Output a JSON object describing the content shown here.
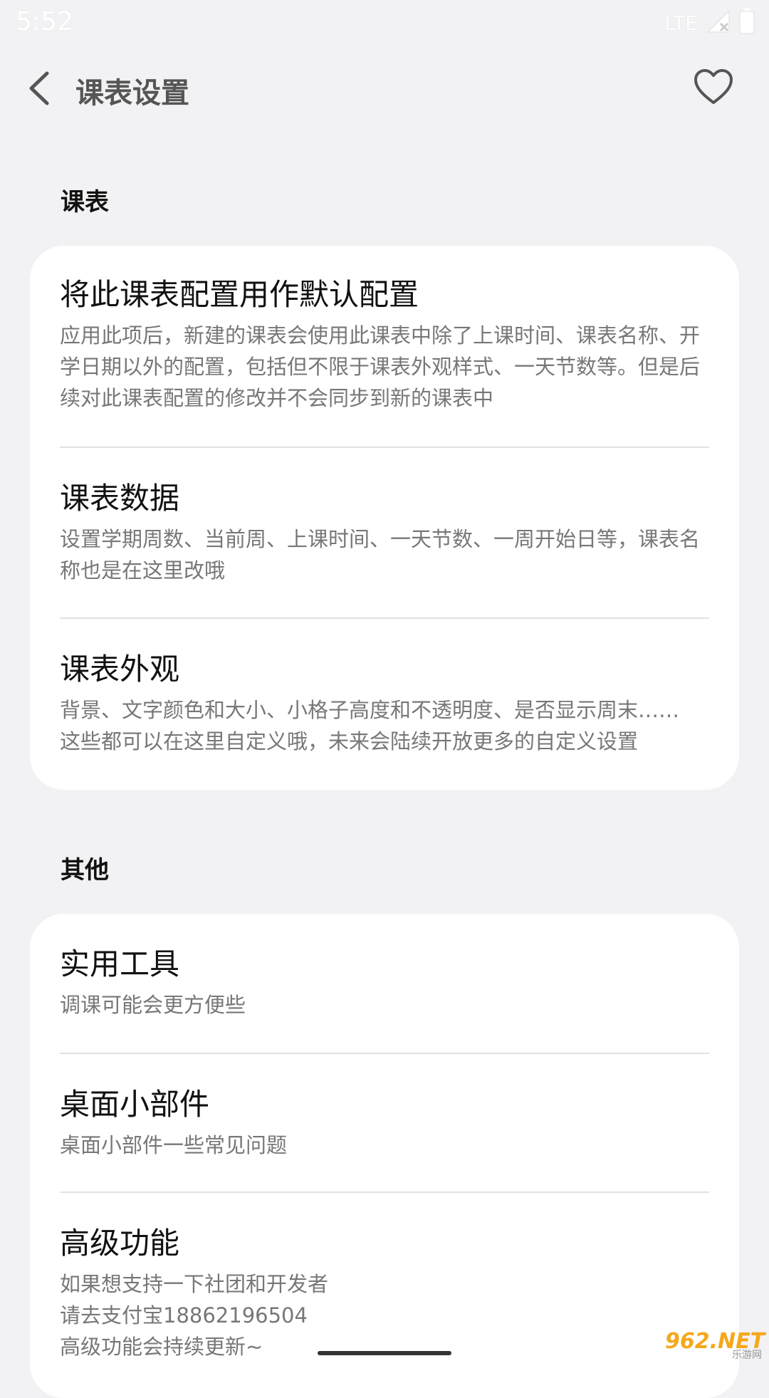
{
  "status_bar": {
    "time": "5:52",
    "network": "LTE"
  },
  "app_bar": {
    "title": "课表设置"
  },
  "sections": [
    {
      "header": "课表",
      "items": [
        {
          "title": "将此课表配置用作默认配置",
          "desc": "应用此项后，新建的课表会使用此课表中除了上课时间、课表名称、开学日期以外的配置，包括但不限于课表外观样式、一天节数等。但是后续对此课表配置的修改并不会同步到新的课表中"
        },
        {
          "title": "课表数据",
          "desc": "设置学期周数、当前周、上课时间、一天节数、一周开始日等，课表名称也是在这里改哦"
        },
        {
          "title": "课表外观",
          "desc": "背景、文字颜色和大小、小格子高度和不透明度、是否显示周末……\n这些都可以在这里自定义哦，未来会陆续开放更多的自定义设置"
        }
      ]
    },
    {
      "header": "其他",
      "items": [
        {
          "title": "实用工具",
          "desc": "调课可能会更方便些"
        },
        {
          "title": "桌面小部件",
          "desc": "桌面小部件一些常见问题"
        },
        {
          "title": "高级功能",
          "desc": "如果想支持一下社团和开发者\n请去支付宝18862196504\n高级功能会持续更新~"
        }
      ]
    }
  ],
  "watermark": {
    "main": "962.NET",
    "sub": "乐游网"
  }
}
